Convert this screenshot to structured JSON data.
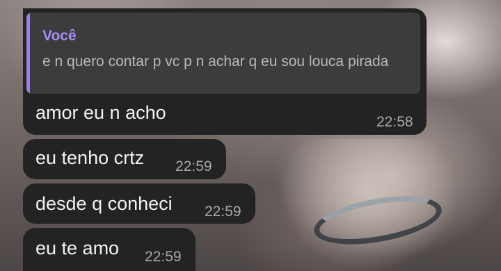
{
  "reply": {
    "author": "Você",
    "text": "e n quero contar p vc p n achar q eu sou louca pirada"
  },
  "messages": [
    {
      "text": "amor eu n  acho",
      "time": "22:58"
    },
    {
      "text": "eu tenho crtz",
      "time": "22:59"
    },
    {
      "text": "desde q conheci",
      "time": "22:59"
    },
    {
      "text": "eu te amo",
      "time": "22:59"
    }
  ],
  "colors": {
    "bubble": "#232323",
    "quote_bg": "#3c3c3c",
    "accent": "#9b7ef0",
    "time": "#a9a9a9"
  }
}
